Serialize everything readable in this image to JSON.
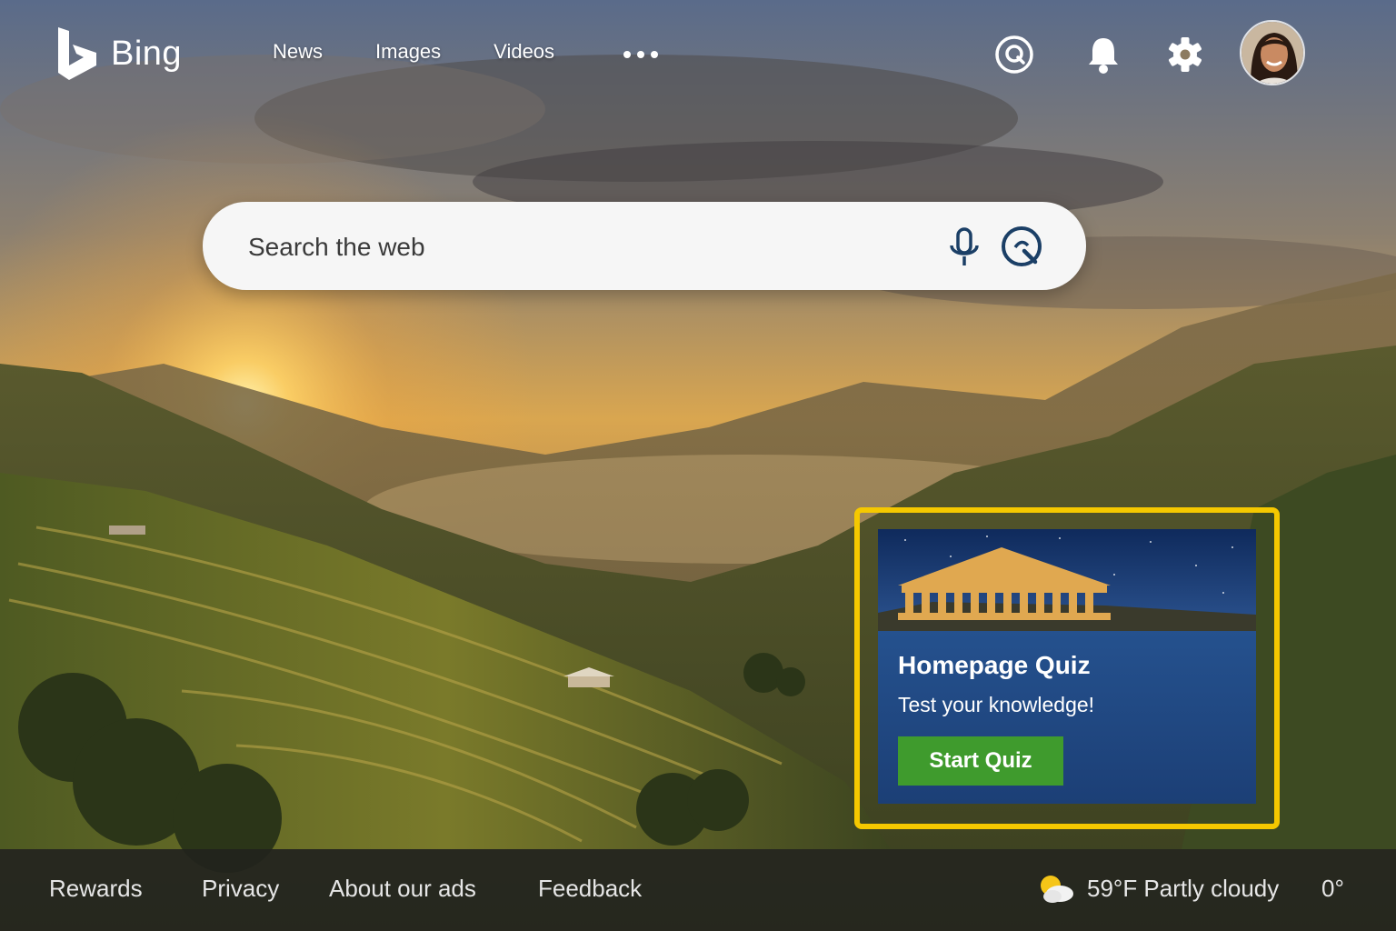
{
  "brand": {
    "name": "Bing"
  },
  "nav": {
    "items": [
      "News",
      "Images",
      "Videos"
    ],
    "more_label": "More"
  },
  "header_icons": [
    "copilot-icon",
    "notifications-icon",
    "settings-icon"
  ],
  "search": {
    "placeholder": "Search the web"
  },
  "quiz": {
    "title": "Homepage Quiz",
    "subtitle": "Test your knowledge!",
    "button_label": "Start Quiz",
    "highlight_color": "#f5c800",
    "button_color": "#3f9b2d"
  },
  "footer": {
    "links": [
      "Rewards",
      "Privacy",
      "About our ads",
      "Feedback"
    ],
    "weather": {
      "icon": "partly-cloudy-icon",
      "text": "59°F Partly cloudy"
    },
    "extra": "0°"
  }
}
